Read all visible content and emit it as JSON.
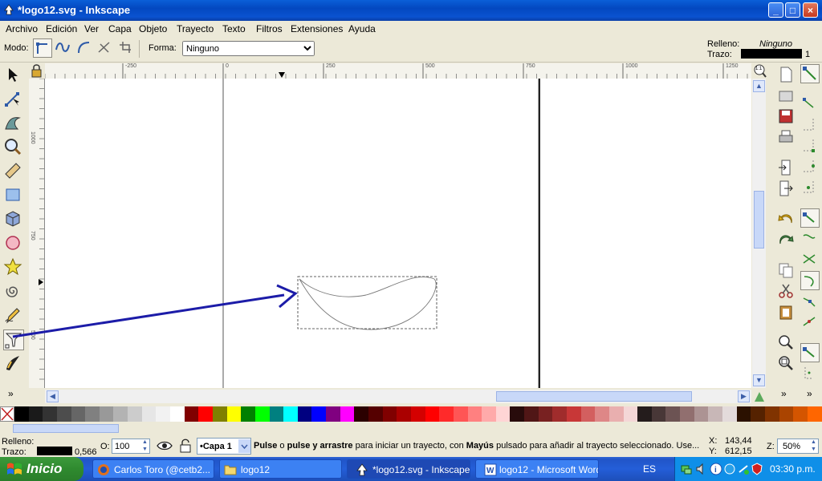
{
  "window": {
    "title": "*logo12.svg - Inkscape",
    "buttons": {
      "minimize": "_",
      "maximize": "□",
      "close": "×"
    }
  },
  "menu": [
    "Archivo",
    "Edición",
    "Ver",
    "Capa",
    "Objeto",
    "Trayecto",
    "Texto",
    "Filtros",
    "Extensiones",
    "Ayuda"
  ],
  "toolcontrols": {
    "mode_label": "Modo:",
    "forma_label": "Forma:",
    "forma_value": "Ninguno",
    "fill_label": "Relleno:",
    "fill_value": "Ninguno",
    "stroke_label": "Trazo:",
    "stroke_width": "1"
  },
  "ruler": {
    "h_ticks": [
      "-250",
      "0",
      "250",
      "500",
      "750",
      "1000",
      "1250"
    ],
    "v_ticks": [
      "1000",
      "750",
      "500"
    ]
  },
  "zoom_corner": "1:1",
  "palette_colors": [
    "#000000",
    "#1a1a1a",
    "#333333",
    "#4d4d4d",
    "#666666",
    "#808080",
    "#999999",
    "#b3b3b3",
    "#cccccc",
    "#e6e6e6",
    "#f2f2f2",
    "#ffffff",
    "#800000",
    "#ff0000",
    "#808000",
    "#ffff00",
    "#008000",
    "#00ff00",
    "#008080",
    "#00ffff",
    "#000080",
    "#0000ff",
    "#800080",
    "#ff00ff",
    "#2b0000",
    "#550000",
    "#800000",
    "#aa0000",
    "#d40000",
    "#ff0000",
    "#ff2a2a",
    "#ff5555",
    "#ff8080",
    "#ffaaaa",
    "#ffd5d5",
    "#280b0b",
    "#501616",
    "#782121",
    "#a02c2c",
    "#c83737",
    "#d35f5f",
    "#de8787",
    "#e9afaf",
    "#f4d7d7",
    "#241c1c",
    "#483737",
    "#6c5353",
    "#916f6f",
    "#ac9393",
    "#c8b7b7",
    "#e3dbdb",
    "#2b1100",
    "#552200",
    "#803300",
    "#aa4400",
    "#d45500",
    "#ff6600"
  ],
  "status": {
    "fill_label": "Relleno:",
    "stroke_label": "Trazo:",
    "stroke_width": "0,566",
    "opacity_label": "O:",
    "opacity_value": "100",
    "layer_value": "•Capa 1",
    "message_bold1": "Pulse",
    "message_plain1": " o ",
    "message_bold2": "pulse y arrastre",
    "message_plain2": " para iniciar un trayecto, con ",
    "message_bold3": "Mayús",
    "message_plain3": " pulsado para añadir al trayecto seleccionado. Use...",
    "x_label": "X:",
    "x_value": "143,44",
    "y_label": "Y:",
    "y_value": "612,15",
    "zoom_label": "Z:",
    "zoom_value": "50%"
  },
  "taskbar": {
    "start_label": "Inicio",
    "tasks": [
      {
        "label": "Carlos Toro (@cetb2...",
        "icon": "firefox-icon"
      },
      {
        "label": "logo12",
        "icon": "folder-icon"
      },
      {
        "label": "*logo12.svg - Inkscape",
        "icon": "inkscape-icon"
      },
      {
        "label": "logo12 - Microsoft Word",
        "icon": "word-icon"
      }
    ],
    "language": "ES",
    "clock": "03:30 p.m."
  },
  "colors": {
    "titlebar": "#0a52d0",
    "annotation_arrow": "#1c1ca8",
    "taskbar": "#245ed8",
    "start": "#2f8a2f"
  }
}
